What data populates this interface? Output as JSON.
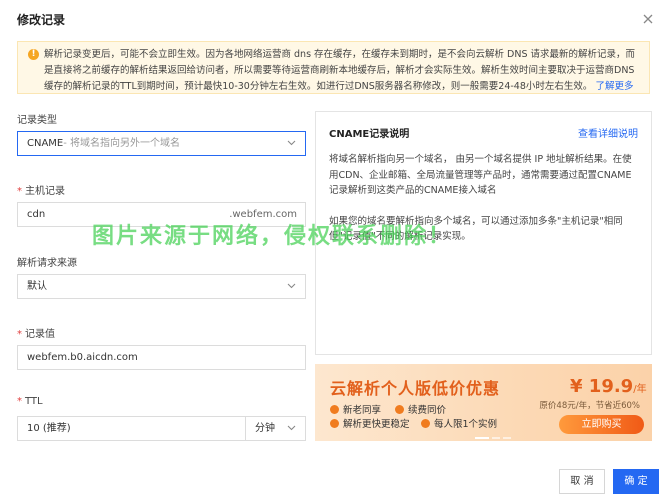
{
  "dialog": {
    "title": "修改记录",
    "notice": {
      "text": "解析记录变更后，可能不会立即生效。因为各地网络运营商 dns 存在缓存，在缓存未到期时，是不会向云解析 DNS 请求最新的解析记录，而是直接将之前缓存的解析结果返回给访问者，所以需要等待运营商刷新本地缓存后，解析才会实际生效。解析生效时间主要取决于运营商DNS缓存的解析记录的TTL到期时间，预计最快10-30分钟左右生效。如进行过DNS服务器名称修改，则一般需要24-48小时左右生效。",
      "link": "了解更多"
    }
  },
  "form": {
    "record_type": {
      "label": "记录类型",
      "value": "CNAME",
      "hint": "- 将域名指向另外一个域名"
    },
    "host": {
      "label": "主机记录",
      "value": "cdn",
      "suffix": ".webfem.com"
    },
    "line": {
      "label": "解析请求来源",
      "value": "默认"
    },
    "record_value": {
      "label": "记录值",
      "value": "webfem.b0.aicdn.com"
    },
    "ttl": {
      "label": "TTL",
      "value": "10 (推荐)",
      "unit": "分钟"
    }
  },
  "help": {
    "title": "CNAME记录说明",
    "link": "查看详细说明",
    "p1": "将域名解析指向另一个域名， 由另一个域名提供 IP 地址解析结果。在使用CDN、企业邮箱、全局流量管理等产品时，通常需要通过配置CNAME记录解析到这类产品的CNAME接入域名",
    "p2": "如果您的域名要解析指向多个域名，可以通过添加多条\"主机记录\"相同但\"记录值\"不同的解析记录实现。"
  },
  "ad": {
    "title": "云解析个人版低价优惠",
    "features": [
      "新老同享",
      "续费同价",
      "解析更快更稳定",
      "每人限1个实例"
    ],
    "price": "¥ 19.9",
    "price_unit": "/年",
    "original": "原价48元/年，节省近60%",
    "buy": "立即购买"
  },
  "watermark": "图片来源于网络，侵权联系删除！",
  "buttons": {
    "cancel": "取 消",
    "ok": "确 定"
  },
  "colors": {
    "primary": "#2468f2",
    "warning": "#f5a623",
    "ad_accent": "#e2601c"
  }
}
